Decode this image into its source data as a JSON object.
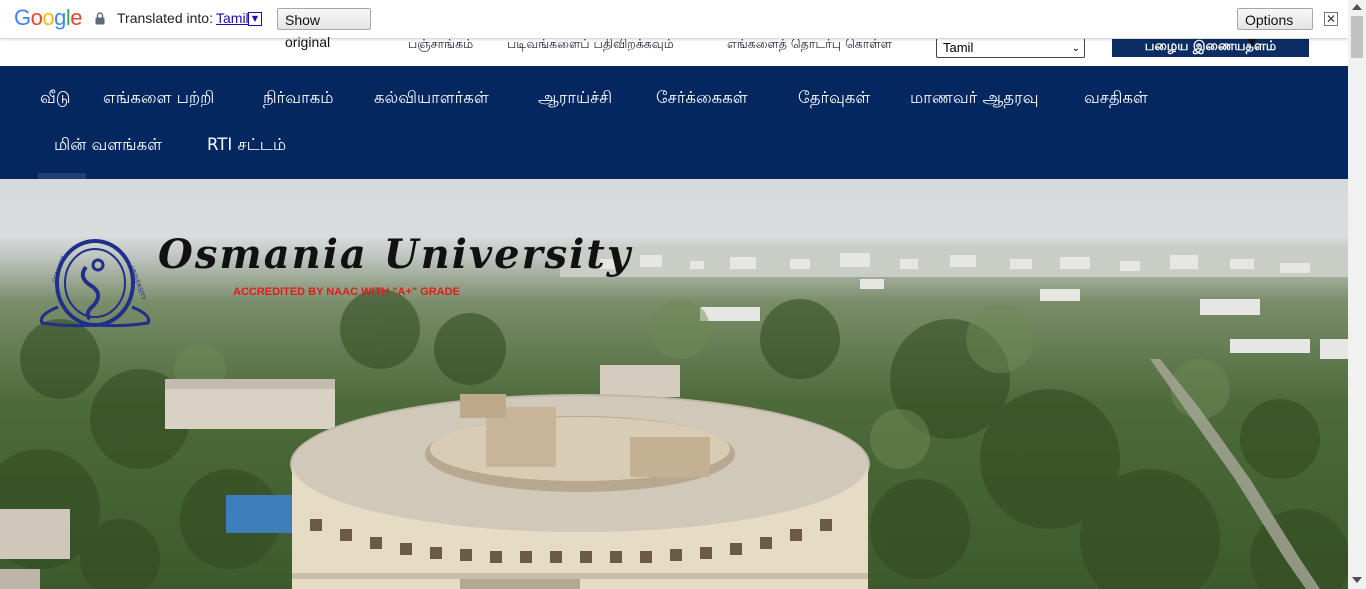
{
  "translate_bar": {
    "logo": {
      "letters": [
        "G",
        "o",
        "o",
        "g",
        "l",
        "e"
      ],
      "colors": [
        "#4285F4",
        "#EA4335",
        "#FBBC05",
        "#4285F4",
        "#34A853",
        "#EA4335"
      ]
    },
    "translated_label": "Translated into:",
    "language": "Tamil",
    "show_original": "Show original",
    "options": "Options ▼",
    "close": "✕"
  },
  "utility": {
    "links": [
      "பஞ்சாங்கம்",
      "படிவங்களைப் பதிவிறக்கவும்",
      "எங்களைத் தொடர்பு கொள்ள"
    ],
    "language_select": "Tamil",
    "old_site_button": "பழைய இணையதளம்"
  },
  "nav": {
    "row1": [
      "வீடு",
      "எங்களை பற்றி",
      "நிர்வாகம்",
      "கல்வியாளர்கள்",
      "ஆராய்ச்சி",
      "சேர்க்கைகள்",
      "தேர்வுகள்",
      "மாணவர் ஆதரவு",
      "வசதிகள்"
    ],
    "row2": [
      "மின் வளங்கள்",
      "RTI சட்டம்"
    ]
  },
  "hero": {
    "title": "Osmania University",
    "accreditation": "ACCREDITED BY NAAC WITH \"A+\" GRADE",
    "seal_text": "OSMANIA UNIVERSITY"
  },
  "colors": {
    "nav_bg": "#04275f",
    "old_site_bg": "#0c2d63",
    "accreditation_red": "#e31b1b"
  }
}
